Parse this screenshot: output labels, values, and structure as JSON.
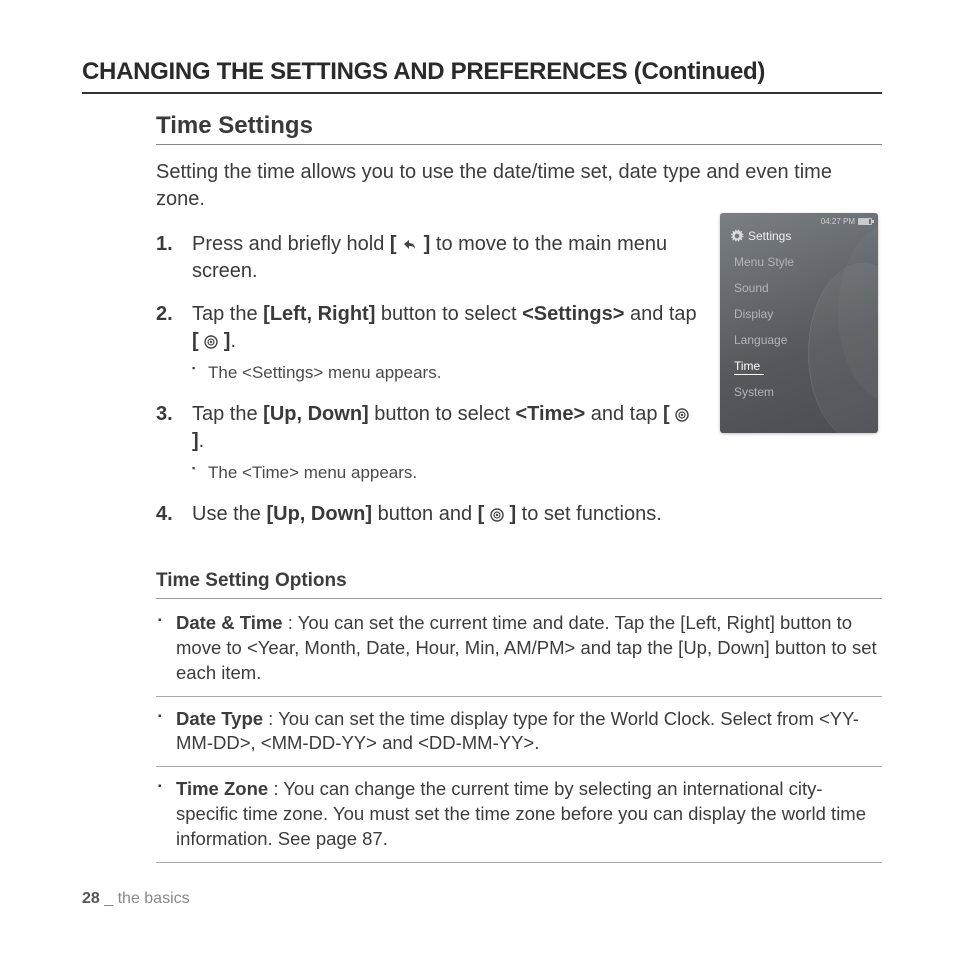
{
  "page_title": "CHANGING THE SETTINGS AND PREFERENCES (Continued)",
  "section_heading": "Time Settings",
  "intro": "Setting the time allows you to use the date/time set, date type and even time zone.",
  "steps": {
    "s1": {
      "num": "1.",
      "p1": "Press and briefly hold ",
      "b1": "[ ",
      "b2": " ]",
      "p2": " to move to the main menu screen."
    },
    "s2": {
      "num": "2.",
      "p1": "Tap the ",
      "b1": "[Left, Right]",
      "p2": " button to select ",
      "b2": "<Settings>",
      "p3": " and tap ",
      "b3": "[ ",
      "b4": " ]",
      "p4": ".",
      "sub": "The <Settings> menu appears."
    },
    "s3": {
      "num": "3.",
      "p1": "Tap the ",
      "b1": "[Up, Down]",
      "p2": " button to select ",
      "b2": "<Time>",
      "p3": " and tap ",
      "b3": "[ ",
      "b4": " ]",
      "p4": ".",
      "sub": "The <Time> menu appears."
    },
    "s4": {
      "num": "4.",
      "p1": "Use the ",
      "b1": "[Up, Down]",
      "p2": " button and ",
      "b2": "[ ",
      "b3": " ]",
      "p3": " to set functions."
    }
  },
  "subheading": "Time Setting Options",
  "options": {
    "o1": {
      "label": "Date & Time",
      "text": " : You can set the current time and date. Tap the [Left, Right] button to move to <Year, Month, Date, Hour, Min, AM/PM> and tap the [Up, Down] button to set each item."
    },
    "o2": {
      "label": "Date Type",
      "text": " : You can set the time display type for the World Clock. Select from <YY-MM-DD>, <MM-DD-YY> and <DD-MM-YY>."
    },
    "o3": {
      "label": "Time Zone",
      "text": " : You can change the current time by selecting an international city-specific time zone. You must set the time zone before you can display the world time information. See page 87."
    }
  },
  "device": {
    "clock": "04:27 PM",
    "title": "Settings",
    "items": [
      "Menu Style",
      "Sound",
      "Display",
      "Language",
      "Time",
      "System"
    ],
    "selected_index": 4
  },
  "footer": {
    "page": "28",
    "sep": " _ ",
    "section": "the basics"
  }
}
